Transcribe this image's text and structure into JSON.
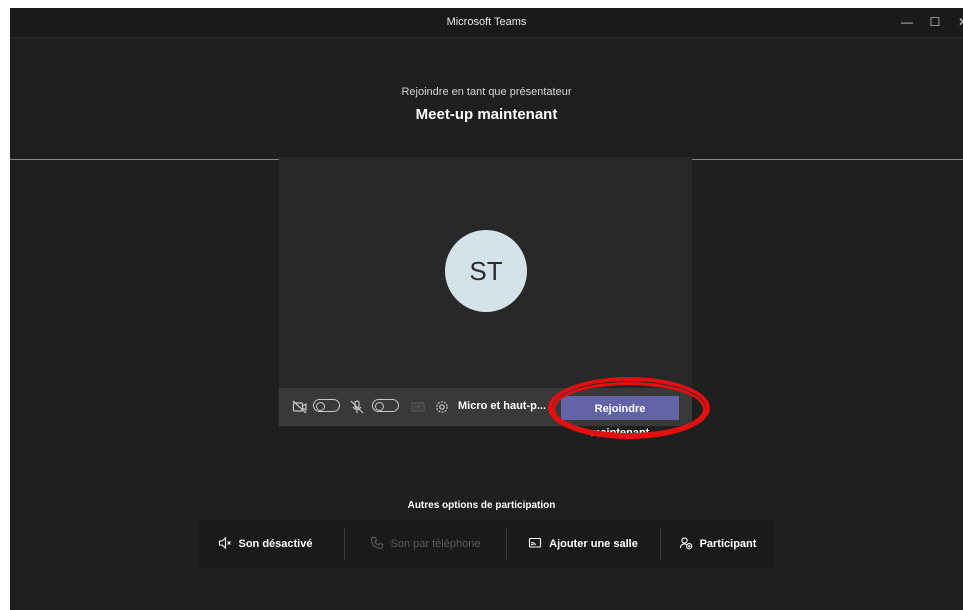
{
  "window": {
    "title": "Microsoft Teams",
    "minimize_glyph": "—",
    "maximize_glyph": "☐",
    "close_glyph": "✕"
  },
  "header": {
    "subtitle": "Rejoindre en tant que présentateur",
    "meeting_title": "Meet-up maintenant"
  },
  "preview": {
    "avatar_initials": "ST",
    "device_label": "Micro et haut-p...",
    "join_button": "Rejoindre maintenant",
    "camera_on": false,
    "mic_on": false
  },
  "other_options": {
    "label": "Autres options de participation",
    "items": [
      {
        "label": "Son désactivé",
        "icon": "speaker-mute-icon",
        "enabled": true
      },
      {
        "label": "Son par téléphone",
        "icon": "phone-icon",
        "enabled": false
      },
      {
        "label": "Ajouter une salle",
        "icon": "cast-icon",
        "enabled": true
      },
      {
        "label": "Participant",
        "icon": "person-add-icon",
        "enabled": true
      }
    ]
  },
  "colors": {
    "accent": "#6264a7",
    "background": "#201f1f",
    "highlight": "#e41010"
  }
}
